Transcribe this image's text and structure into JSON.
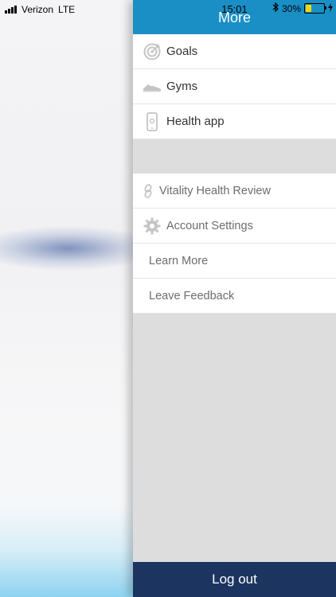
{
  "status_bar": {
    "carrier": "Verizon",
    "network": "LTE",
    "time": "15:01",
    "battery_percent": "30%",
    "battery_level": 0.3
  },
  "header": {
    "title": "More"
  },
  "menu_primary": [
    {
      "label": "Goals",
      "icon": "target-icon"
    },
    {
      "label": "Gyms",
      "icon": "shoe-icon"
    },
    {
      "label": "Health app",
      "icon": "phone-icon"
    }
  ],
  "menu_secondary": [
    {
      "label": "Vitality Health Review",
      "icon": "link-icon"
    },
    {
      "label": "Account Settings",
      "icon": "gear-icon"
    },
    {
      "label": "Learn More"
    },
    {
      "label": "Leave Feedback"
    }
  ],
  "footer": {
    "logout_label": "Log out"
  },
  "colors": {
    "header_bg": "#1a8fc6",
    "logout_bg": "#1c3560",
    "drawer_bg": "#dddddd",
    "icon_gray": "#c5c5c5"
  }
}
